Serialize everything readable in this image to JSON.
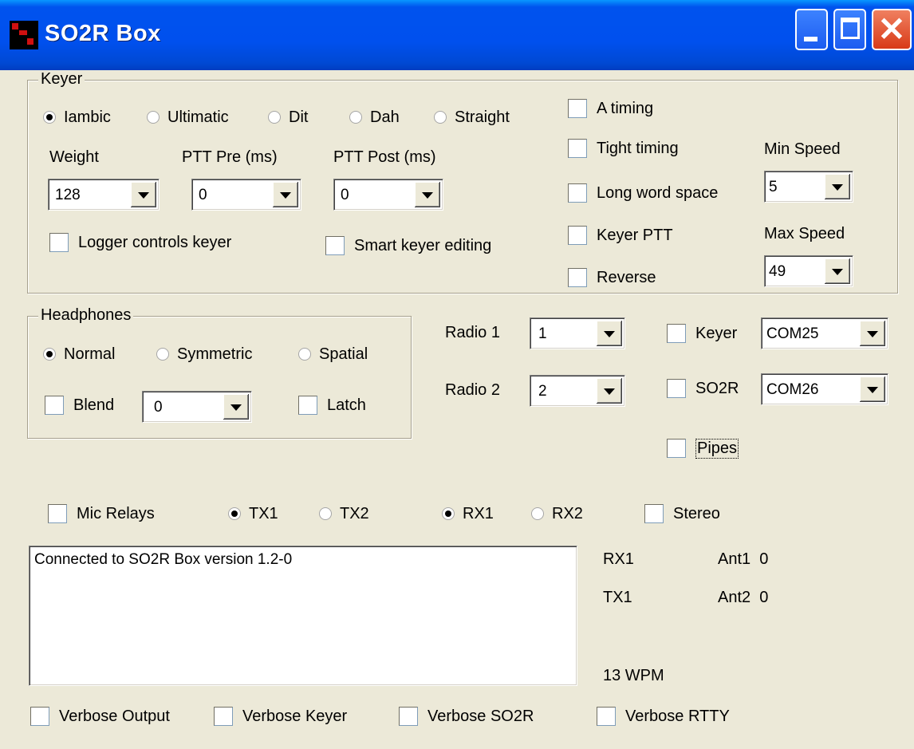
{
  "window": {
    "title": "SO2R Box"
  },
  "keyer": {
    "legend": "Keyer",
    "modes": [
      "Iambic",
      "Ultimatic",
      "Dit",
      "Dah",
      "Straight"
    ],
    "selected_mode": "Iambic",
    "weight": {
      "label": "Weight",
      "value": "128"
    },
    "ptt_pre": {
      "label": "PTT Pre (ms)",
      "value": "0"
    },
    "ptt_post": {
      "label": "PTT Post (ms)",
      "value": "0"
    },
    "logger_controls_keyer": {
      "label": "Logger controls keyer",
      "checked": false
    },
    "smart_keyer_editing": {
      "label": "Smart keyer editing",
      "checked": false
    },
    "a_timing": {
      "label": "A timing",
      "checked": false
    },
    "tight_timing": {
      "label": "Tight timing",
      "checked": false
    },
    "long_word_space": {
      "label": "Long word space",
      "checked": false
    },
    "keyer_ptt": {
      "label": "Keyer PTT",
      "checked": false
    },
    "reverse": {
      "label": "Reverse",
      "checked": false
    },
    "min_speed": {
      "label": "Min Speed",
      "value": "5"
    },
    "max_speed": {
      "label": "Max Speed",
      "value": "49"
    }
  },
  "headphones": {
    "legend": "Headphones",
    "modes": [
      "Normal",
      "Symmetric",
      "Spatial"
    ],
    "selected_mode": "Normal",
    "blend": {
      "label": "Blend",
      "checked": false,
      "value": "0"
    },
    "latch": {
      "label": "Latch",
      "checked": false
    }
  },
  "radios": {
    "radio1": {
      "label": "Radio 1",
      "value": "1"
    },
    "radio2": {
      "label": "Radio 2",
      "value": "2"
    }
  },
  "ports": {
    "keyer": {
      "label": "Keyer",
      "checked": false,
      "value": "COM25"
    },
    "so2r": {
      "label": "SO2R",
      "checked": false,
      "value": "COM26"
    },
    "pipes": {
      "label": "Pipes",
      "checked": false
    }
  },
  "relays": {
    "mic_relays": {
      "label": "Mic Relays",
      "checked": false
    },
    "tx": [
      "TX1",
      "TX2"
    ],
    "tx_selected": "TX1",
    "rx": [
      "RX1",
      "RX2"
    ],
    "rx_selected": "RX1",
    "stereo": {
      "label": "Stereo",
      "checked": false
    }
  },
  "log": {
    "text": "Connected to SO2R Box version 1.2-0"
  },
  "status": {
    "rx": "RX1",
    "tx": "TX1",
    "ant1": "Ant1  0",
    "ant2": "Ant2  0",
    "wpm": "13 WPM"
  },
  "verbose": {
    "output": {
      "label": "Verbose Output",
      "checked": false
    },
    "keyer": {
      "label": "Verbose Keyer",
      "checked": false
    },
    "so2r": {
      "label": "Verbose SO2R",
      "checked": false
    },
    "rtty": {
      "label": "Verbose RTTY",
      "checked": false
    }
  }
}
